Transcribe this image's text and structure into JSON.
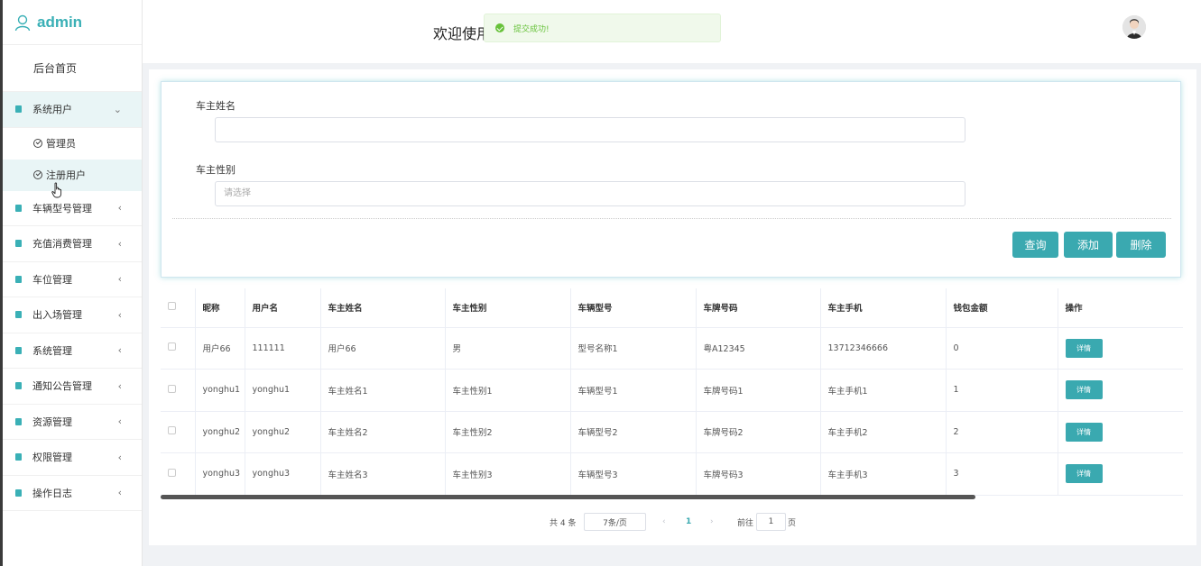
{
  "app": {
    "brand": "admin",
    "welcome": "欢迎使用"
  },
  "toast": {
    "message": "提交成功!"
  },
  "sidebar": {
    "home": "后台首页",
    "items": [
      {
        "label": "系统用户",
        "chevron": "⌄"
      },
      {
        "label": "车辆型号管理",
        "chevron": "‹"
      },
      {
        "label": "充值消费管理",
        "chevron": "‹"
      },
      {
        "label": "车位管理",
        "chevron": "‹"
      },
      {
        "label": "出入场管理",
        "chevron": "‹"
      },
      {
        "label": "系统管理",
        "chevron": "‹"
      },
      {
        "label": "通知公告管理",
        "chevron": "‹"
      },
      {
        "label": "资源管理",
        "chevron": "‹"
      },
      {
        "label": "权限管理",
        "chevron": "‹"
      },
      {
        "label": "操作日志",
        "chevron": "‹"
      }
    ],
    "sub_items": [
      {
        "label": "管理员"
      },
      {
        "label": "注册用户"
      }
    ]
  },
  "search": {
    "owner_name_label": "车主姓名",
    "owner_name_value": "",
    "owner_gender_label": "车主性别",
    "owner_gender_placeholder": "请选择",
    "query_label": "查询",
    "add_label": "添加",
    "delete_label": "删除"
  },
  "table": {
    "headers": [
      "昵称",
      "用户名",
      "车主姓名",
      "车主性别",
      "车辆型号",
      "车牌号码",
      "车主手机",
      "钱包金额",
      "操作"
    ],
    "rows": [
      {
        "nickname": "用户66",
        "username": "111111",
        "name": "用户66",
        "gender": "男",
        "model": "型号名称1",
        "plate": "粤A12345",
        "phone": "13712346666",
        "wallet": "0",
        "action": "详情"
      },
      {
        "nickname": "yonghu1",
        "username": "yonghu1",
        "name": "车主姓名1",
        "gender": "车主性别1",
        "model": "车辆型号1",
        "plate": "车牌号码1",
        "phone": "车主手机1",
        "wallet": "1",
        "action": "详情"
      },
      {
        "nickname": "yonghu2",
        "username": "yonghu2",
        "name": "车主姓名2",
        "gender": "车主性别2",
        "model": "车辆型号2",
        "plate": "车牌号码2",
        "phone": "车主手机2",
        "wallet": "2",
        "action": "详情"
      },
      {
        "nickname": "yonghu3",
        "username": "yonghu3",
        "name": "车主姓名3",
        "gender": "车主性别3",
        "model": "车辆型号3",
        "plate": "车牌号码3",
        "phone": "车主手机3",
        "wallet": "3",
        "action": "详情"
      }
    ]
  },
  "pagination": {
    "total": "共 4 条",
    "page_size": "7条/页",
    "prev": "‹",
    "current": "1",
    "next": "›",
    "goto_label": "前往",
    "goto_value": "1",
    "page_suffix": "页"
  },
  "colors": {
    "accent": "#3aa9b0",
    "brand": "#3ab0b6",
    "success": "#67c23a"
  }
}
